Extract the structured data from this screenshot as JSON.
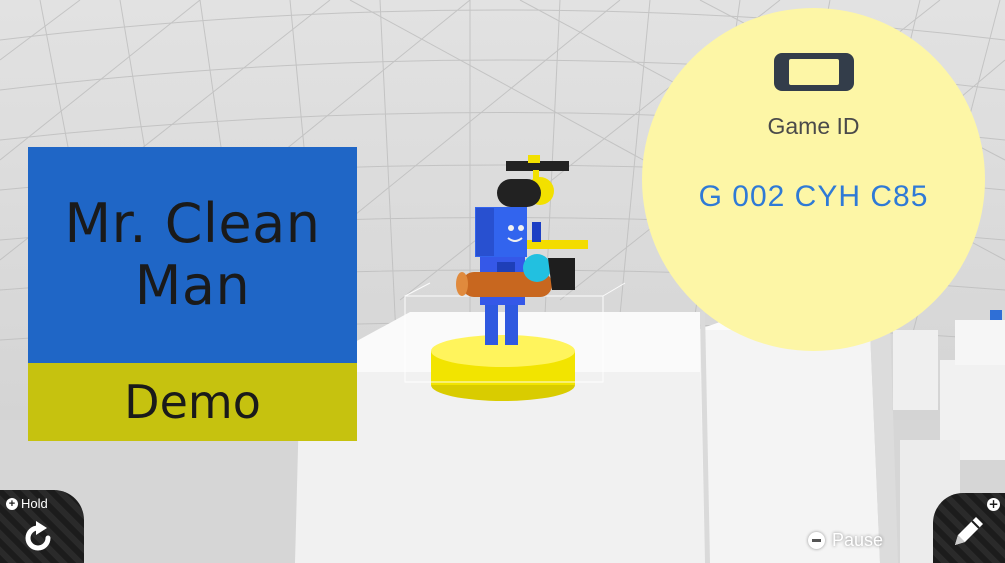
{
  "title_card": {
    "title_line1": "Mr. Clean",
    "title_line2": "Man",
    "subtitle": "Demo",
    "top_color": "#1f66c6",
    "bottom_color": "#c6c20f"
  },
  "game_id": {
    "label": "Game ID",
    "value": "G 002 CYH C85",
    "icon": "handheld-console-icon",
    "bubble_color": "#fdf6a6",
    "value_color": "#2f7ad6"
  },
  "controls": {
    "hold_label": "Hold",
    "hold_icon": "rotate-icon",
    "pause_label": "Pause",
    "pause_icon": "minus-button-icon",
    "edit_icon": "pencil-icon"
  }
}
